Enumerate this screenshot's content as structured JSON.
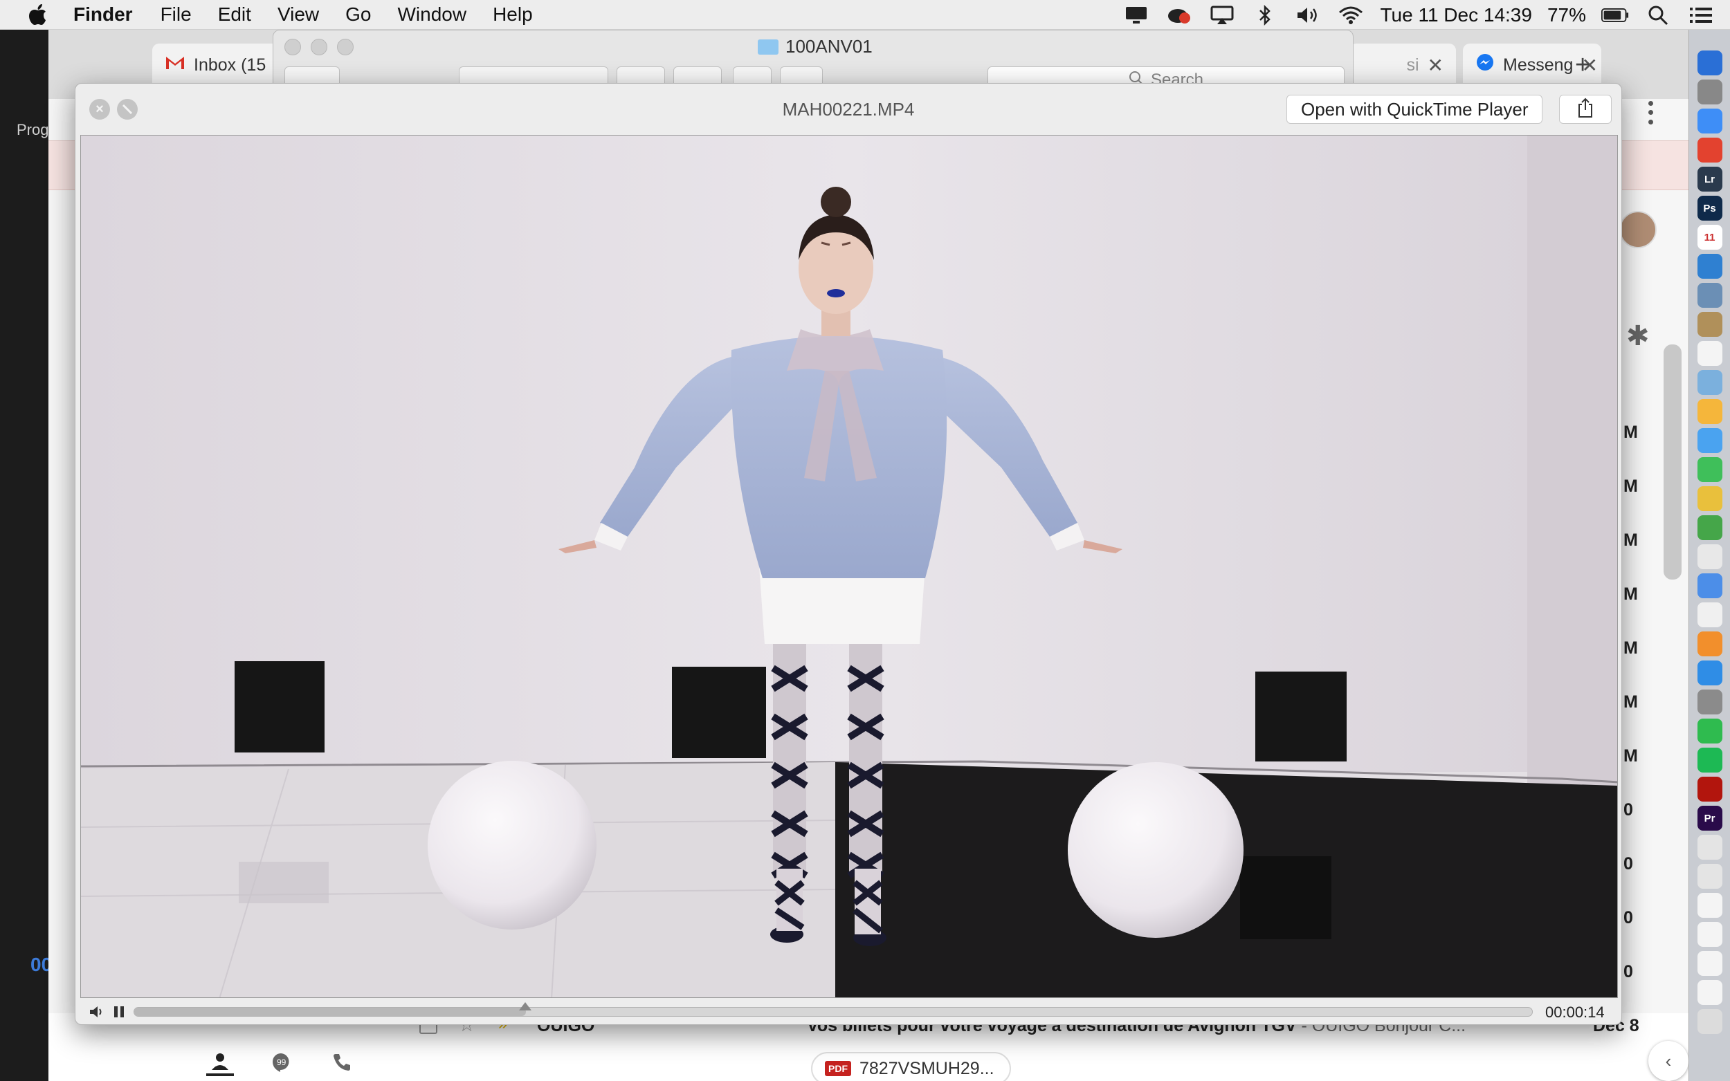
{
  "menubar": {
    "app_name": "Finder",
    "menus": [
      "File",
      "Edit",
      "View",
      "Go",
      "Window",
      "Help"
    ],
    "datetime": "Tue 11 Dec  14:39",
    "battery": "77%"
  },
  "background_app": {
    "left_label": "Prog",
    "left_blue": "00"
  },
  "chrome": {
    "tabs": [
      {
        "label": "Inbox (15",
        "icon": "gmail-icon"
      },
      {
        "label": "si",
        "icon": ""
      },
      {
        "label": "Messeng",
        "icon": "messenger-icon"
      }
    ],
    "row_letters": [
      "M",
      "M",
      "M",
      "M",
      "M",
      "M",
      "M",
      "0",
      "0",
      "0",
      "0"
    ],
    "mail": {
      "sender": "OUIGO",
      "subject": "Vos billets pour votre voyage à destination de Avignon TGV",
      "snippet": " - OUIGO Bonjour C...",
      "date": "Dec 8",
      "attachment": "7827VSMUH29..."
    }
  },
  "finder": {
    "title": "100ANV01",
    "search_placeholder": "Search"
  },
  "quicklook": {
    "title": "MAH00221.MP4",
    "open_with": "Open with QuickTime Player",
    "time": "00:00:14",
    "progress": 0.28
  },
  "colors": {
    "wall": "#e4e0e4",
    "sweater": "#a9b6d6",
    "floor_dark": "#1c1b1c",
    "floor_light": "#dedade"
  }
}
